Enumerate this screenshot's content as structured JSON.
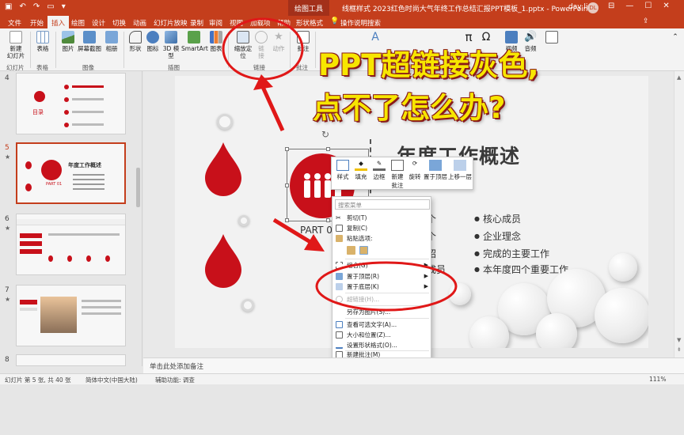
{
  "titlebar": {
    "contextual_tab_label": "绘图工具",
    "document_title": "线框样式 2023红色时尚大气年终工作总结汇报PPT模板_1.pptx - PowerPoint",
    "user_name": "day li",
    "avatar_initials": "DL"
  },
  "tabs": [
    {
      "label": "文件"
    },
    {
      "label": "开始"
    },
    {
      "label": "插入",
      "active": true
    },
    {
      "label": "绘图"
    },
    {
      "label": "设计"
    },
    {
      "label": "切换"
    },
    {
      "label": "动画"
    },
    {
      "label": "幻灯片放映"
    },
    {
      "label": "录制"
    },
    {
      "label": "审阅"
    },
    {
      "label": "视图"
    },
    {
      "label": "加载项"
    },
    {
      "label": "帮助"
    },
    {
      "label": "形状格式"
    }
  ],
  "tell_me": "操作说明搜索",
  "share_icon": "share-icon",
  "ribbon": {
    "new_slide": "新建\n幻灯片",
    "table": "表格",
    "picture": "图片",
    "screenshot": "屏幕截图",
    "album": "相册",
    "shapes": "形状",
    "icons": "图标",
    "model3d": "3D 模\n型",
    "smartart": "SmartArt",
    "chart": "图表",
    "zoom": "缩放定\n位",
    "link": "链\n接",
    "action": "动作",
    "comment": "批注",
    "equation": "π",
    "symbol": "Ω",
    "video": "视频",
    "audio": "音频",
    "groups": {
      "slides": "幻灯片",
      "tables": "表格",
      "images": "图像",
      "illustrations": "插图",
      "links": "链接",
      "comments": "批注"
    }
  },
  "slides_pane": {
    "items": [
      {
        "number": "4",
        "star": "★"
      },
      {
        "number": "5",
        "star": "★",
        "selected": true
      },
      {
        "number": "6",
        "star": "★"
      },
      {
        "number": "7",
        "star": "★"
      },
      {
        "number": "8",
        "star": "★"
      }
    ],
    "thumb4_label": "目录",
    "thumb5_title": "年度工作概述",
    "thumb5_sub": "PART 01"
  },
  "slide": {
    "title": "年度工作概述",
    "part_label": "PART 01",
    "bullets": [
      "核心成员",
      "企业理念",
      "完成的主要工作",
      "本年度四个重要工作"
    ],
    "left_fragments": [
      "个",
      "个",
      "绍",
      "成员"
    ]
  },
  "mini_toolbar": {
    "style": "样式",
    "fill": "填充",
    "outline": "边框",
    "new_comment": "新建\n批注",
    "rotate": "旋转",
    "bring_front": "置于顶层",
    "send_back": "置于底层",
    "up_one": "上移一层"
  },
  "context_menu": {
    "search_placeholder": "搜索菜单",
    "items": [
      {
        "label": "剪切(T)",
        "icon": "scissors-icon"
      },
      {
        "label": "复制(C)",
        "icon": "copy-icon"
      },
      {
        "label": "粘贴选项:",
        "icon": "paste-icon"
      },
      {
        "label": "组合(G)",
        "icon": "group-icon",
        "submenu": true
      },
      {
        "label": "置于顶层(R)",
        "icon": "bring-front-icon",
        "submenu": true
      },
      {
        "label": "置于底层(K)",
        "icon": "send-back-icon",
        "submenu": true
      },
      {
        "label": "超链接(H)...",
        "icon": "link-icon",
        "disabled": true
      },
      {
        "label": "另存为图片(S)..."
      },
      {
        "label": "查看可选文字(A)...",
        "icon": "alt-text-icon"
      },
      {
        "label": "大小和位置(Z)...",
        "icon": "size-icon"
      },
      {
        "label": "设置形状格式(O)...",
        "icon": "format-shape-icon"
      },
      {
        "label": "新建批注(M)",
        "icon": "new-comment-icon"
      }
    ]
  },
  "overlay": {
    "line1": "PPT超链接灰色,",
    "line2": "点不了怎么办?"
  },
  "notes_placeholder": "单击此处添加备注",
  "status": {
    "slide_info": "幻灯片 第 5 张, 共 40 张",
    "language": "简体中文(中国大陆)",
    "accessibility": "辅助功能: 调查",
    "zoom": "111%"
  },
  "colors": {
    "brand": "#c43e1c",
    "slide_red": "#c8101a",
    "overlay_text": "#f7e600",
    "annotation": "#e01818"
  }
}
